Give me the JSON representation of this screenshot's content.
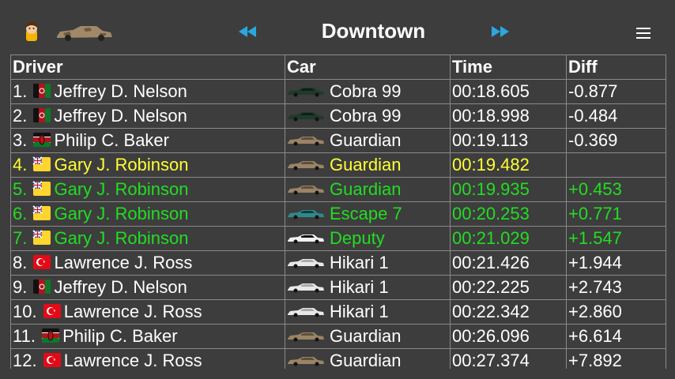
{
  "header": {
    "title": "Downtown",
    "prev_icon": "rewind-icon",
    "next_icon": "fast-forward-icon",
    "menu_icon": "hamburger-menu-icon",
    "avatar_icon": "driver-avatar-icon",
    "car_icon": "camo-car-icon"
  },
  "columns": [
    "Driver",
    "Car",
    "Time",
    "Diff"
  ],
  "colors": {
    "background": "#3d3d3d",
    "text": "#ffffff",
    "highlight_yellow": "#ffff33",
    "highlight_green": "#22dd22",
    "arrow": "#29a8e0",
    "grid": "#8a8a8a"
  },
  "rows": [
    {
      "rank": "1.",
      "flag": "afghanistan-flag-icon",
      "driver": "Jeffrey D. Nelson",
      "car_icon": "dark-green-car-icon",
      "car": "Cobra 99",
      "time": "00:18.605",
      "diff": "-0.877",
      "style": "normal"
    },
    {
      "rank": "2.",
      "flag": "afghanistan-flag-icon",
      "driver": "Jeffrey D. Nelson",
      "car_icon": "dark-green-car-icon",
      "car": "Cobra 99",
      "time": "00:18.998",
      "diff": "-0.484",
      "style": "normal"
    },
    {
      "rank": "3.",
      "flag": "kenya-flag-icon",
      "driver": "Philip C. Baker",
      "car_icon": "camo-car-icon",
      "car": "Guardian",
      "time": "00:19.113",
      "diff": "-0.369",
      "style": "normal"
    },
    {
      "rank": "4.",
      "flag": "niue-flag-icon",
      "driver": "Gary J. Robinson",
      "car_icon": "camo-car-icon",
      "car": "Guardian",
      "time": "00:19.482",
      "diff": "",
      "style": "yellow"
    },
    {
      "rank": "5.",
      "flag": "niue-flag-icon",
      "driver": "Gary J. Robinson",
      "car_icon": "camo-car-icon",
      "car": "Guardian",
      "time": "00:19.935",
      "diff": "+0.453",
      "style": "green"
    },
    {
      "rank": "6.",
      "flag": "niue-flag-icon",
      "driver": "Gary J. Robinson",
      "car_icon": "teal-car-icon",
      "car": "Escape 7",
      "time": "00:20.253",
      "diff": "+0.771",
      "style": "green"
    },
    {
      "rank": "7.",
      "flag": "niue-flag-icon",
      "driver": "Gary J. Robinson",
      "car_icon": "police-car-icon",
      "car": "Deputy",
      "time": "00:21.029",
      "diff": "+1.547",
      "style": "green"
    },
    {
      "rank": "8.",
      "flag": "turkey-flag-icon",
      "driver": "Lawrence J. Ross",
      "car_icon": "white-car-icon",
      "car": "Hikari 1",
      "time": "00:21.426",
      "diff": "+1.944",
      "style": "normal"
    },
    {
      "rank": "9.",
      "flag": "afghanistan-flag-icon",
      "driver": "Jeffrey D. Nelson",
      "car_icon": "white-car-icon",
      "car": "Hikari 1",
      "time": "00:22.225",
      "diff": "+2.743",
      "style": "normal"
    },
    {
      "rank": "10.",
      "flag": "turkey-flag-icon",
      "driver": "Lawrence J. Ross",
      "car_icon": "white-car-icon",
      "car": "Hikari 1",
      "time": "00:22.342",
      "diff": "+2.860",
      "style": "normal"
    },
    {
      "rank": "11.",
      "flag": "kenya-flag-icon",
      "driver": "Philip C. Baker",
      "car_icon": "camo-car-icon",
      "car": "Guardian",
      "time": "00:26.096",
      "diff": "+6.614",
      "style": "normal"
    },
    {
      "rank": "12.",
      "flag": "turkey-flag-icon",
      "driver": "Lawrence J. Ross",
      "car_icon": "camo-car-icon",
      "car": "Guardian",
      "time": "00:27.374",
      "diff": "+7.892",
      "style": "normal"
    }
  ]
}
